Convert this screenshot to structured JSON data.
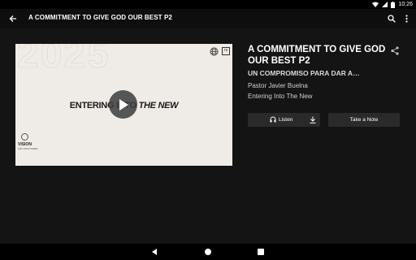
{
  "status_bar": {
    "time": "10:26",
    "icons": [
      "wifi-icon",
      "signal-icon",
      "battery-icon"
    ]
  },
  "app_bar": {
    "title": "A COMMITMENT TO GIVE GOD OUR BEST P2",
    "icons": [
      "back-arrow-icon",
      "search-icon",
      "more-vert-icon"
    ]
  },
  "video": {
    "watermark": "2025",
    "headline_plain": "ENTERING INTO ",
    "headline_italic": "THE NEW",
    "corner_logo": "TS",
    "brand": "VISION",
    "brand_small": "2025 VISION SERIES"
  },
  "details": {
    "title": "A COMMITMENT TO GIVE GOD OUR BEST P2",
    "subtitle": "UN COMPROMISO PARA DAR A…",
    "speaker": "Pastor Javier Buelna",
    "series": "Entering Into The New"
  },
  "actions": {
    "listen_label": "Listen",
    "note_label": "Take a Note"
  },
  "colors": {
    "background": "#141414",
    "app_bar": "#0e0e0e",
    "button": "#2a2a2a",
    "video_bg": "#efebe6"
  }
}
